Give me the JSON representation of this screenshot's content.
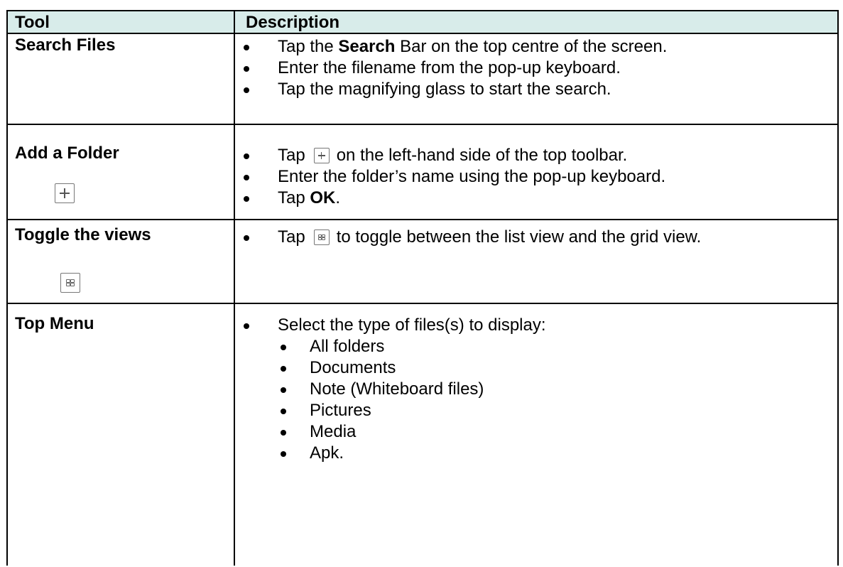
{
  "header": {
    "tool": "Tool",
    "description": "Description"
  },
  "rows": [
    {
      "tool": "Search Files",
      "icon": null,
      "bullets": [
        {
          "pre": "Tap the ",
          "bold": "Search",
          "post": " Bar on the top centre of the screen."
        },
        {
          "text": "Enter the filename from the pop-up keyboard."
        },
        {
          "text": "Tap the magnifying glass to start the search."
        }
      ]
    },
    {
      "tool": "Add a Folder",
      "icon": "plus-icon",
      "bullets": [
        {
          "pre": "Tap",
          "icon": "plus-icon",
          "post": "on the left-hand side of the top toolbar."
        },
        {
          "text": "Enter the folder’s name using the pop-up keyboard."
        },
        {
          "pre": "Tap ",
          "bold": "OK",
          "post": "."
        }
      ]
    },
    {
      "tool": "Toggle the views",
      "icon": "grid-view-icon",
      "bullets": [
        {
          "pre": "Tap",
          "icon": "grid-view-icon",
          "post": "to toggle between the list view and the grid view."
        }
      ]
    },
    {
      "tool": "Top Menu",
      "icon": null,
      "bullets": [
        {
          "text": "Select the type of files(s) to display:"
        }
      ],
      "subitems": [
        "All folders",
        "Documents",
        "Note (Whiteboard files)",
        "Pictures",
        "Media",
        "Apk."
      ]
    }
  ]
}
